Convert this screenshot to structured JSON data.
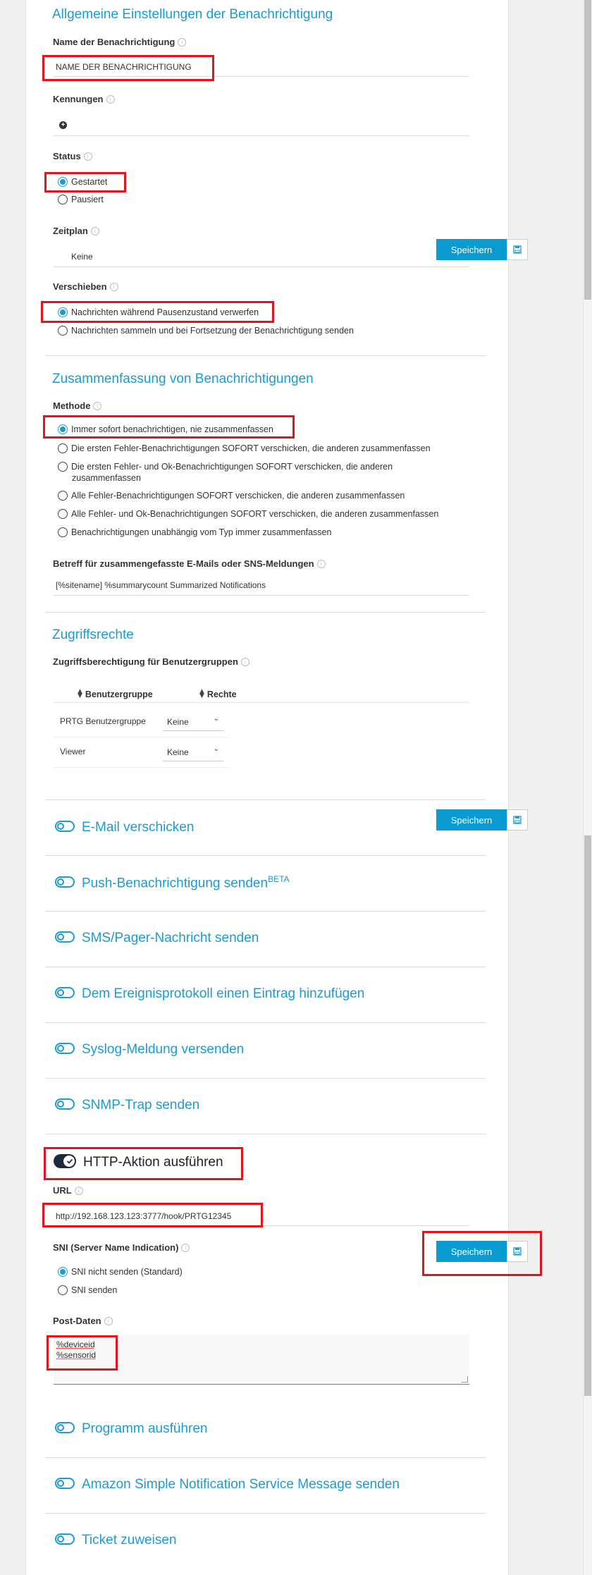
{
  "general": {
    "title": "Allgemeine Einstellungen der Benachrichtigung",
    "name_label": "Name der Benachrichtigung",
    "name_value": "NAME DER BENACHRICHTIGUNG",
    "tags_label": "Kennungen",
    "status_label": "Status",
    "status_started": "Gestartet",
    "status_paused": "Pausiert",
    "schedule_label": "Zeitplan",
    "schedule_value": "Keine",
    "postpone_label": "Verschieben",
    "postpone_opt1": "Nachrichten während Pausenzustand verwerfen",
    "postpone_opt2": "Nachrichten sammeln und bei Fortsetzung der Benachrichtigung senden"
  },
  "summary": {
    "title": "Zusammenfassung von Benachrichtigungen",
    "method_label": "Methode",
    "options": [
      "Immer sofort benachrichtigen, nie zusammenfassen",
      "Die ersten Fehler-Benachrichtigungen SOFORT verschicken, die anderen zusammenfassen",
      "Die ersten Fehler- und Ok-Benachrichtigungen SOFORT verschicken, die anderen",
      "zusammenfassen",
      "Alle Fehler-Benachrichtigungen SOFORT verschicken, die anderen zusammenfassen",
      "Alle Fehler- und Ok-Benachrichtigungen SOFORT verschicken, die anderen zusammenfassen",
      "Benachrichtigungen unabhängig vom Typ immer zusammenfassen"
    ],
    "subject_label": "Betreff für zusammengefasste E-Mails oder SNS-Meldungen",
    "subject_value": "[%sitename] %summarycount Summarized Notifications"
  },
  "access": {
    "title": "Zugriffsrechte",
    "label": "Zugriffsberechtigung für Benutzergruppen",
    "col_group": "Benutzergruppe",
    "col_rights": "Rechte",
    "rows": [
      {
        "group": "PRTG Benutzergruppe",
        "rights": "Keine"
      },
      {
        "group": "Viewer",
        "rights": "Keine"
      }
    ]
  },
  "save_label": "Speichern",
  "actions": {
    "email": "E-Mail verschicken",
    "push": "Push-Benachrichtigung senden",
    "push_badge": "BETA",
    "sms": "SMS/Pager-Nachricht senden",
    "eventlog": "Dem Ereignisprotokoll einen Eintrag hinzufügen",
    "syslog": "Syslog-Meldung versenden",
    "snmp": "SNMP-Trap senden",
    "http": "HTTP-Aktion ausführen",
    "program": "Programm ausführen",
    "amazon": "Amazon Simple Notification Service Message senden",
    "ticket": "Ticket zuweisen"
  },
  "http": {
    "url_label": "URL",
    "url_value": "http://192.168.123.123:3777/hook/PRTG12345",
    "sni_label": "SNI (Server Name Indication)",
    "sni_opt1": "SNI nicht senden (Standard)",
    "sni_opt2": "SNI senden",
    "post_label": "Post-Daten",
    "post_line1": "%deviceid",
    "post_line2": "%sensorid"
  },
  "colors": {
    "accent": "#1b9bd2",
    "button": "#0a9bd3",
    "highlight": "#e3151c"
  }
}
